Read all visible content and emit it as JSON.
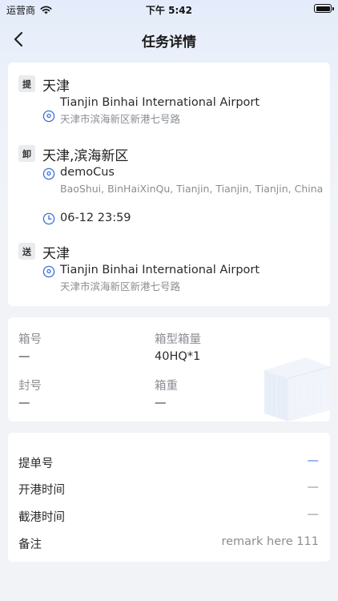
{
  "status_bar": {
    "carrier": "运营商",
    "time": "下午 5:42"
  },
  "nav": {
    "title": "任务详情"
  },
  "route": {
    "pickup": {
      "badge": "提",
      "city": "天津",
      "location_name": "Tianjin Binhai International Airport",
      "address": "天津市滨海新区新港七号路"
    },
    "unload": {
      "badge": "卸",
      "city": "天津,滨海新区",
      "location_name": "demoCus",
      "address": "BaoShui, BinHaiXinQu, Tianjin, Tianjin, Tianjin, China",
      "datetime": "06-12 23:59"
    },
    "delivery": {
      "badge": "送",
      "city": "天津",
      "location_name": "Tianjin Binhai International Airport",
      "address": "天津市滨海新区新港七号路"
    }
  },
  "container": {
    "box_no_label": "箱号",
    "box_no_value": "—",
    "box_type_label": "箱型箱量",
    "box_type_value": "40HQ*1",
    "seal_label": "封号",
    "seal_value": "—",
    "weight_label": "箱重",
    "weight_value": "—"
  },
  "details": {
    "bl_label": "提单号",
    "bl_value": "—",
    "open_label": "开港时间",
    "open_value": "—",
    "cutoff_label": "截港时间",
    "cutoff_value": "—",
    "remark_label": "备注",
    "remark_value": "remark here 111"
  },
  "colors": {
    "accent": "#3a6fd8",
    "muted": "#8a8d93",
    "badge_bg": "#e9ebef"
  }
}
